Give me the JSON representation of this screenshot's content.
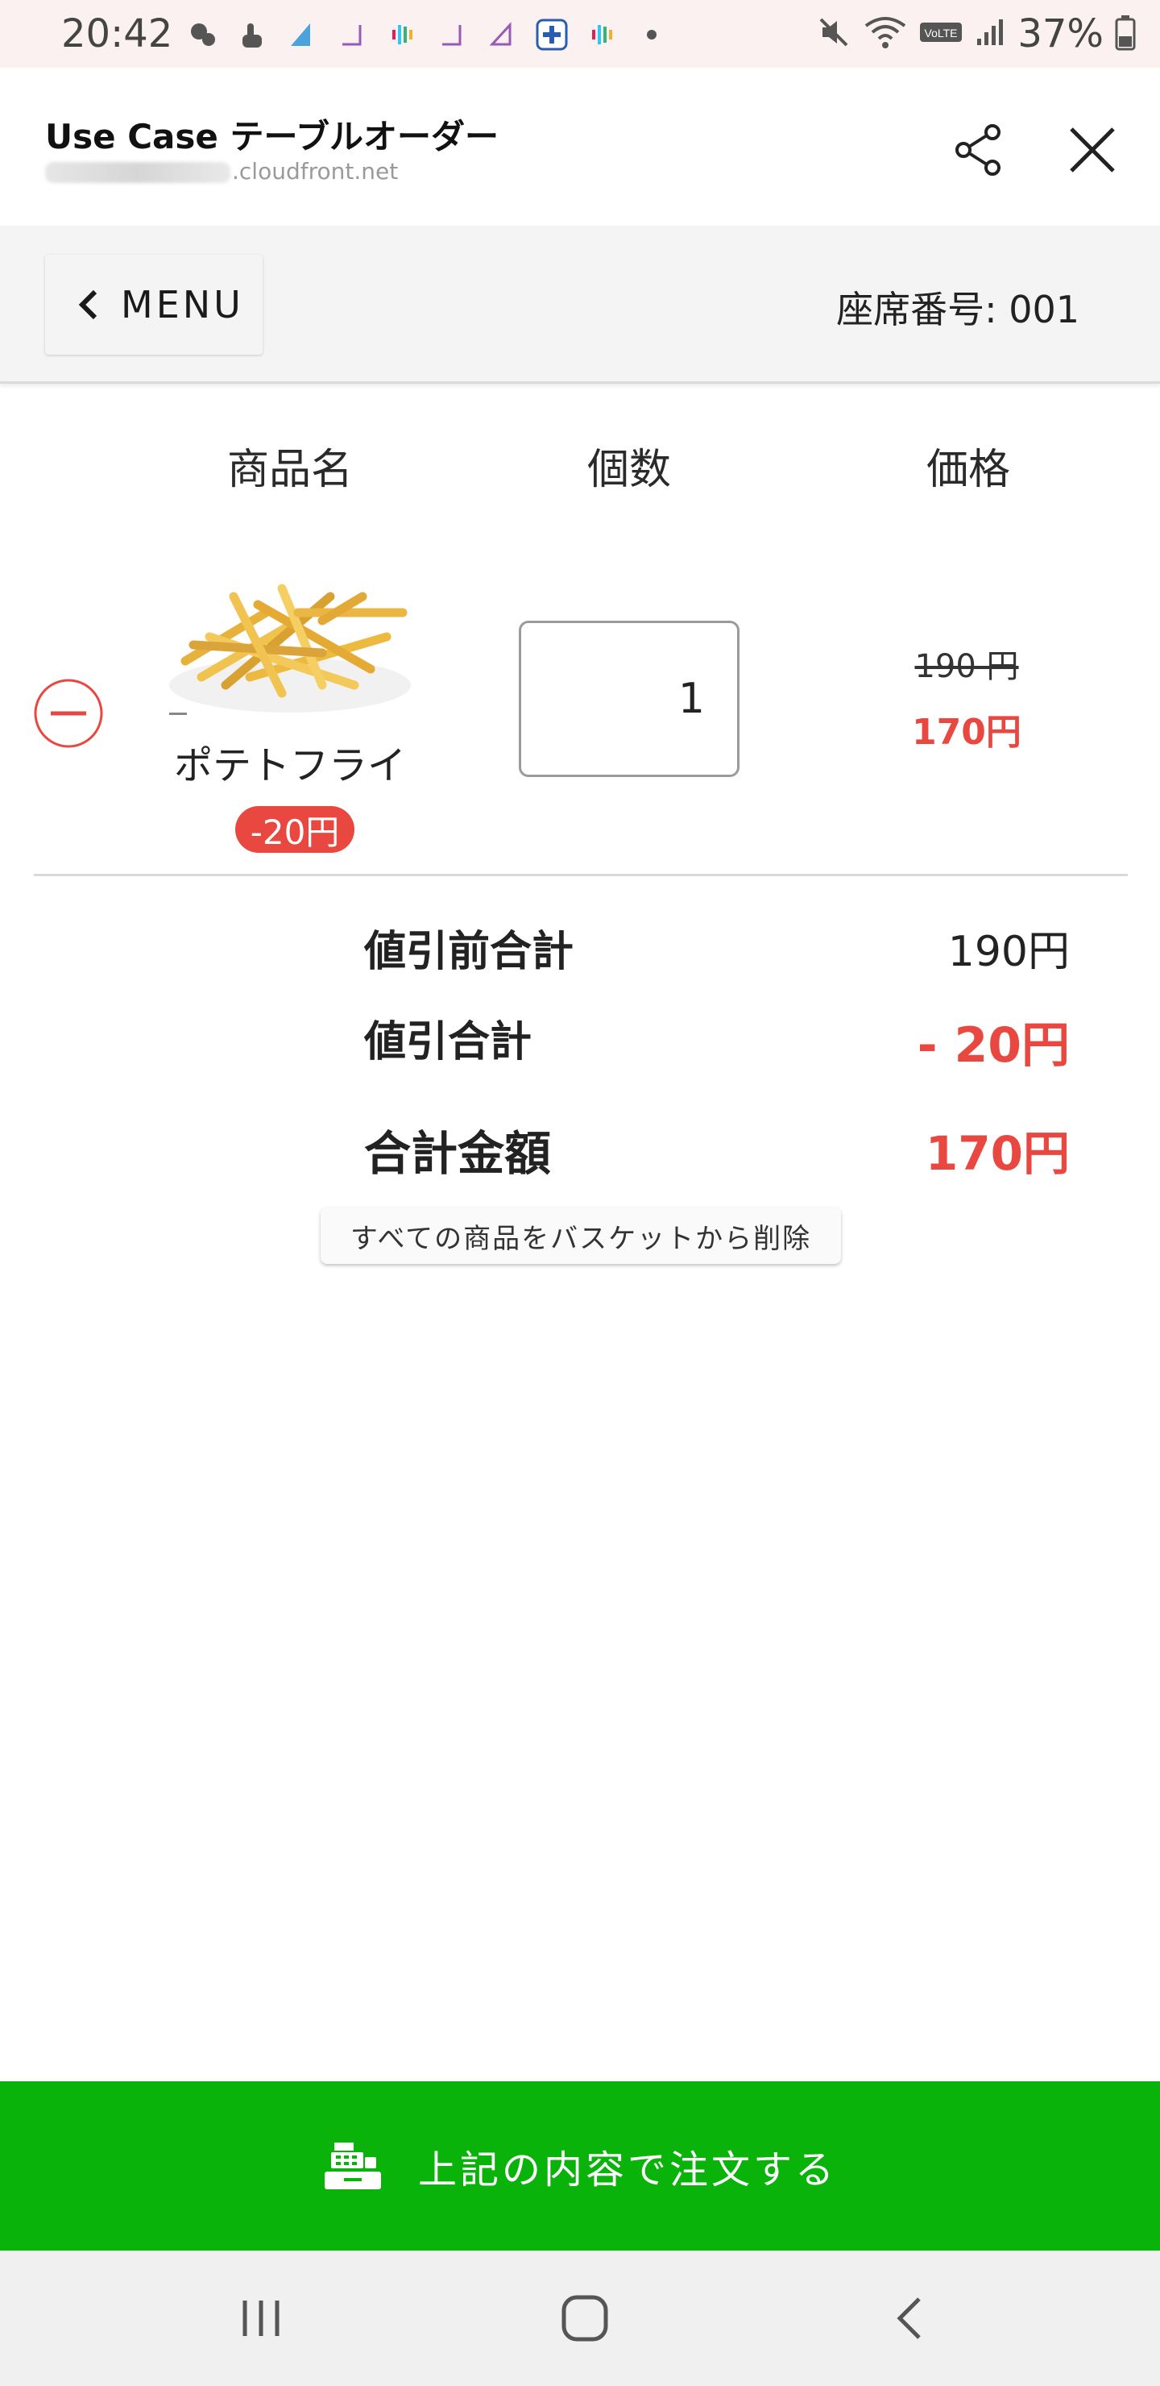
{
  "status_bar": {
    "time": "20:42",
    "battery": "37%",
    "notification_icons": [
      "mascot-icon",
      "touch-icon",
      "triangle-icon",
      "corner-icon",
      "slack-icon",
      "corner-icon",
      "corner-icon",
      "plus-icon",
      "slack-icon",
      "dot-icon"
    ],
    "system_icons": [
      "mute-icon",
      "wifi-icon",
      "volte-icon",
      "signal-icon",
      "battery-icon"
    ]
  },
  "header": {
    "title": "Use Case テーブルオーダー",
    "url_suffix": ".cloudfront.net"
  },
  "menu_bar": {
    "menu_label": "MENU",
    "seat_number": "座席番号: 001"
  },
  "table": {
    "columns": [
      "商品名",
      "個数",
      "価格"
    ],
    "items": [
      {
        "name": "ポテトフライ",
        "discount_badge": "-20円",
        "quantity": "1",
        "original_price": "190 円",
        "discounted_price": "170円"
      }
    ]
  },
  "summary": {
    "subtotal_label": "値引前合計",
    "subtotal_value": "190円",
    "discount_label": "値引合計",
    "discount_value": "- 20円",
    "total_label": "合計金額",
    "total_value": "170円"
  },
  "clear_basket_label": "すべての商品をバスケットから削除",
  "order_button_label": "上記の内容で注文する",
  "colors": {
    "accent_red": "#e84840",
    "order_green": "#0ab30a"
  }
}
